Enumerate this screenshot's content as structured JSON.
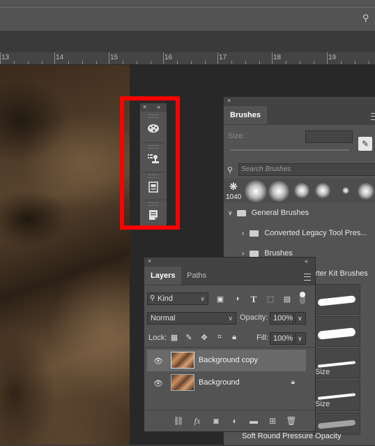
{
  "ruler": {
    "numbers": [
      "13",
      "14",
      "15",
      "16",
      "17",
      "18",
      "19"
    ]
  },
  "dock": {
    "close": "×",
    "collapse": "»",
    "icons": [
      "palette-icon",
      "tool-presets-icon",
      "properties-icon",
      "notes-icon"
    ]
  },
  "brushes": {
    "close": "×",
    "tab": "Brushes",
    "size_label": "Size:",
    "search_placeholder": "Search Brushes",
    "recent_count": "1040",
    "rows": [
      {
        "label": "General Brushes"
      },
      {
        "label": "Converted Legacy Tool Pres..."
      },
      {
        "label": "Brushes"
      },
      {
        "label": "rter Kit Brushes"
      }
    ],
    "size_fragments": [
      "Size",
      "Size"
    ],
    "footer": "Soft Round Pressure Opacity"
  },
  "layers": {
    "close": "×",
    "collapse": "«",
    "tabs": [
      "Layers",
      "Paths"
    ],
    "filter": "Kind",
    "blend_mode": "Normal",
    "opacity_label": "Opacity:",
    "opacity_value": "100%",
    "lock_label": "Lock:",
    "fill_label": "Fill:",
    "fill_value": "100%",
    "items": [
      {
        "name": "Background copy",
        "selected": true
      },
      {
        "name": "Background",
        "selected": false
      }
    ],
    "bottom_icons": [
      "link-icon",
      "fx-icon",
      "mask-icon",
      "adjustment-icon",
      "group-icon",
      "new-layer-icon",
      "trash-icon"
    ]
  }
}
